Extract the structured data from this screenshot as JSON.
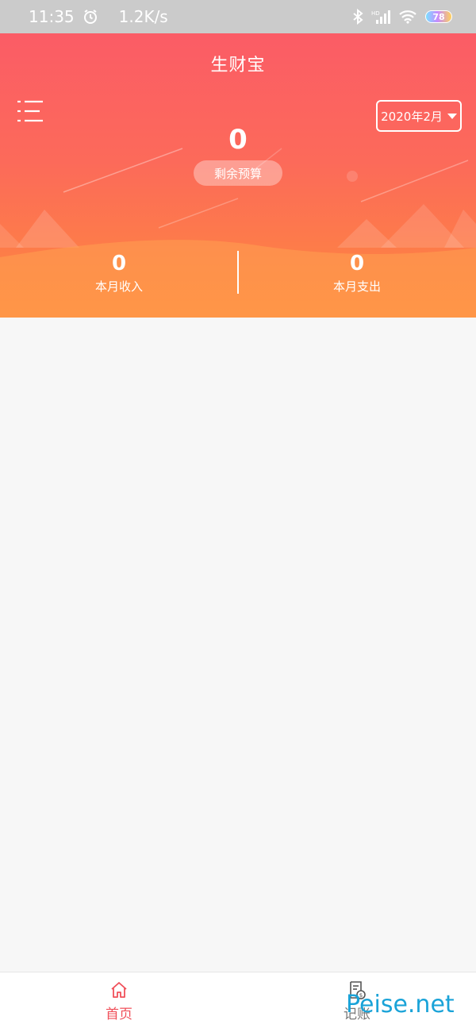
{
  "status_bar": {
    "time": "11:35",
    "speed": "1.2K/s",
    "battery": "78",
    "icons": [
      "alarm-icon",
      "bluetooth-icon",
      "hd-signal-icon",
      "wifi-icon",
      "battery-icon"
    ]
  },
  "header": {
    "title": "生财宝",
    "month_selector": "2020年2月",
    "budget_value": "0",
    "budget_label": "剩余预算",
    "income_value": "0",
    "income_label": "本月收入",
    "expense_value": "0",
    "expense_label": "本月支出"
  },
  "bottom_nav": {
    "items": [
      {
        "label": "首页",
        "icon": "home-icon",
        "active": true
      },
      {
        "label": "记账",
        "icon": "bill-icon",
        "active": false
      }
    ]
  },
  "watermark": "Peise.net",
  "colors": {
    "header_top": "#fb5c66",
    "header_bottom": "#fe8a3c",
    "active_nav": "#f0505a",
    "background": "#f7f7f7"
  }
}
